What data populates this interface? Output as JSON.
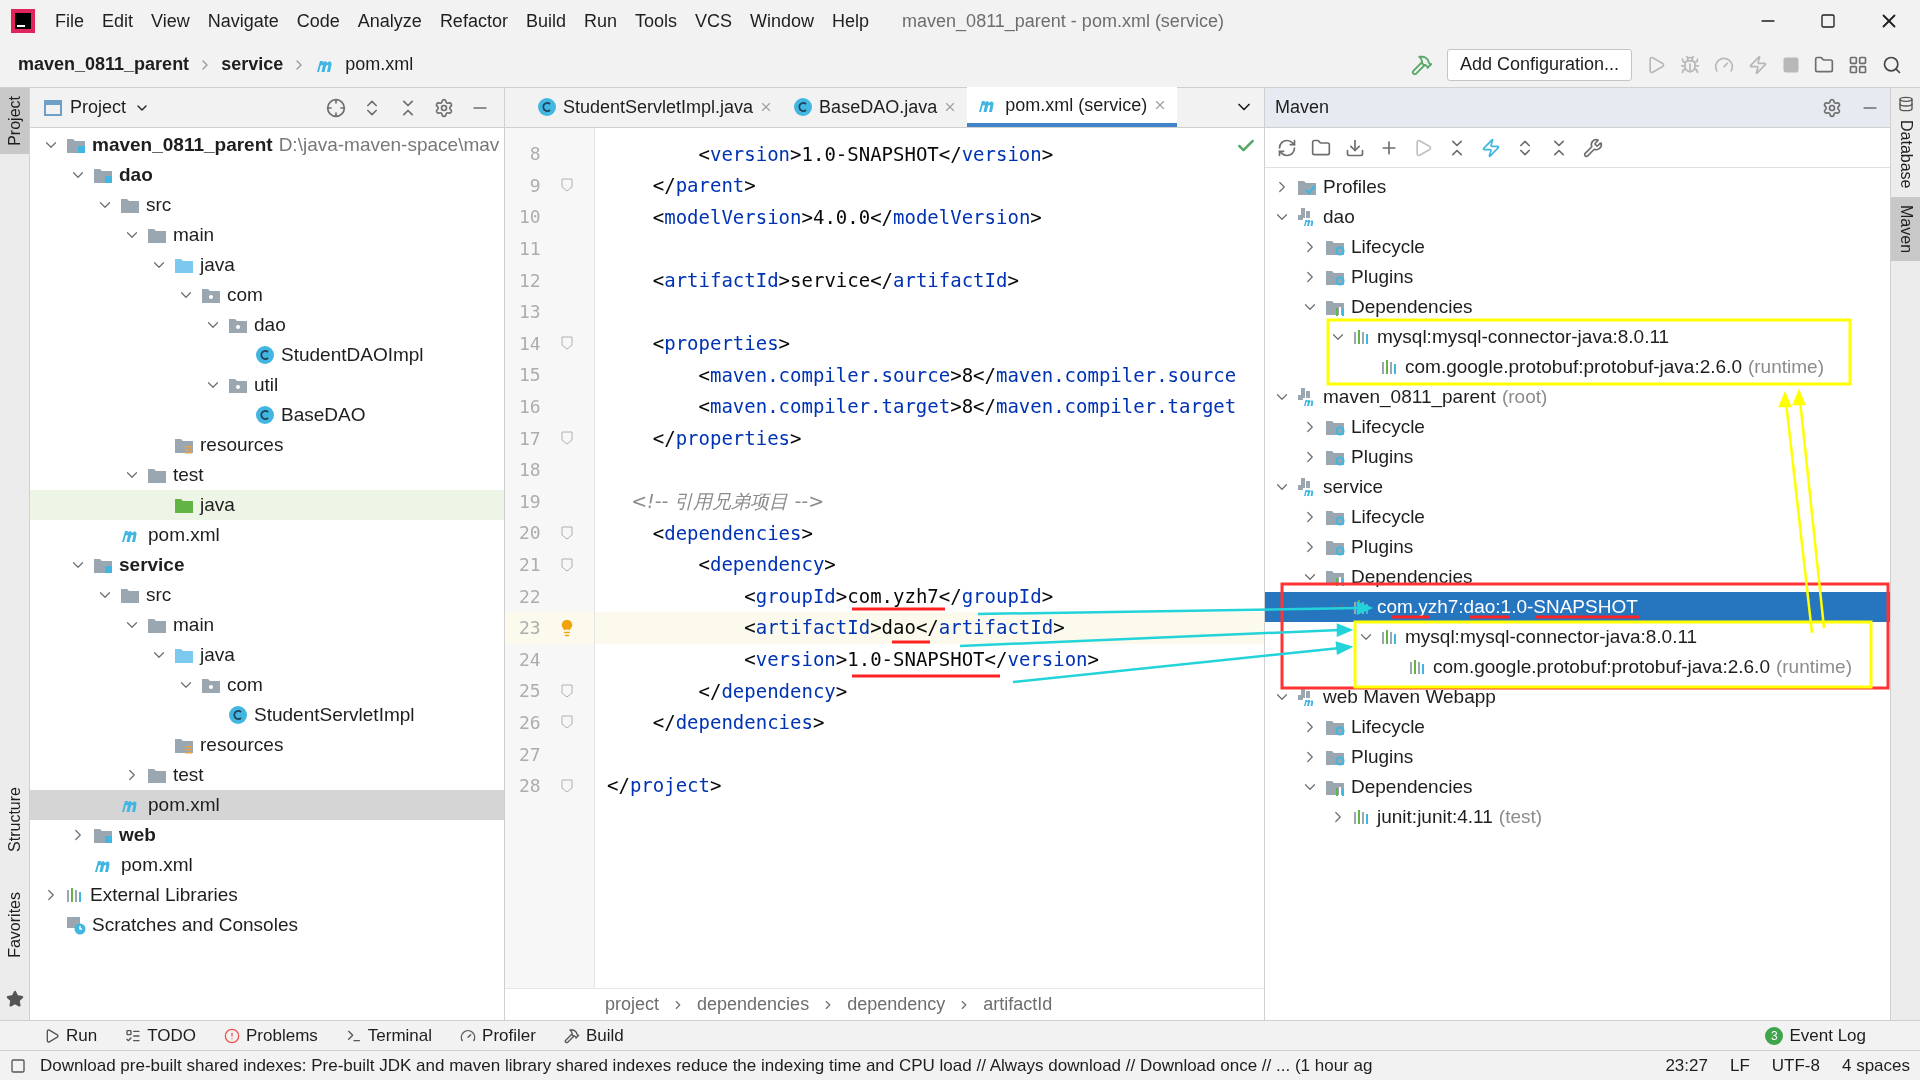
{
  "window": {
    "title": "maven_0811_parent - pom.xml (service)"
  },
  "menu": [
    "File",
    "Edit",
    "View",
    "Navigate",
    "Code",
    "Analyze",
    "Refactor",
    "Build",
    "Run",
    "Tools",
    "VCS",
    "Window",
    "Help"
  ],
  "nav_bar": {
    "crumbs": [
      {
        "label": "maven_0811_parent",
        "kind": "project"
      },
      {
        "label": "service",
        "kind": "module"
      },
      {
        "label": "pom.xml",
        "kind": "pom"
      }
    ],
    "run_config": "Add Configuration..."
  },
  "left_strip": [
    {
      "label": "Project",
      "selected": true
    },
    {
      "label": "Structure",
      "selected": false
    },
    {
      "label": "Favorites",
      "selected": false
    }
  ],
  "right_strip": [
    {
      "label": "Database",
      "selected": false
    },
    {
      "label": "Maven",
      "selected": true
    }
  ],
  "project_panel": {
    "title": "Project",
    "tree": [
      {
        "label": "maven_0811_parent",
        "kind": "module",
        "bold": true,
        "hint": "D:\\java-maven-space\\mav",
        "expanded": true,
        "selected": false,
        "children": [
          {
            "label": "dao",
            "kind": "module",
            "bold": true,
            "expanded": true,
            "selected": false,
            "children": [
              {
                "label": "src",
                "kind": "folder",
                "bold": false,
                "expanded": true,
                "selected": false,
                "children": [
                  {
                    "label": "main",
                    "kind": "folder",
                    "bold": false,
                    "expanded": true,
                    "selected": false,
                    "children": [
                      {
                        "label": "java",
                        "kind": "source",
                        "bold": false,
                        "expanded": true,
                        "selected": false,
                        "children": [
                          {
                            "label": "com",
                            "kind": "package",
                            "bold": false,
                            "expanded": true,
                            "selected": false,
                            "children": [
                              {
                                "label": "dao",
                                "kind": "package",
                                "bold": false,
                                "expanded": true,
                                "selected": false,
                                "children": [
                                  {
                                    "label": "StudentDAOImpl",
                                    "kind": "class",
                                    "bold": false,
                                    "selected": false
                                  }
                                ]
                              },
                              {
                                "label": "util",
                                "kind": "package",
                                "bold": false,
                                "expanded": true,
                                "selected": false,
                                "children": [
                                  {
                                    "label": "BaseDAO",
                                    "kind": "class",
                                    "bold": false,
                                    "selected": false
                                  }
                                ]
                              }
                            ]
                          }
                        ]
                      },
                      {
                        "label": "resources",
                        "kind": "resources",
                        "bold": false,
                        "selected": false
                      }
                    ]
                  },
                  {
                    "label": "test",
                    "kind": "folder",
                    "bold": false,
                    "expanded": true,
                    "selected": false,
                    "children": [
                      {
                        "label": "java",
                        "kind": "test-source",
                        "bold": false,
                        "selected": false
                      }
                    ]
                  }
                ]
              },
              {
                "label": "pom.xml",
                "kind": "pom",
                "bold": false,
                "selected": false
              }
            ]
          },
          {
            "label": "service",
            "kind": "module",
            "bold": true,
            "expanded": true,
            "selected": false,
            "children": [
              {
                "label": "src",
                "kind": "folder",
                "bold": false,
                "expanded": true,
                "selected": false,
                "children": [
                  {
                    "label": "main",
                    "kind": "folder",
                    "bold": false,
                    "expanded": true,
                    "selected": false,
                    "children": [
                      {
                        "label": "java",
                        "kind": "source",
                        "bold": false,
                        "expanded": true,
                        "selected": false,
                        "children": [
                          {
                            "label": "com",
                            "kind": "package",
                            "bold": false,
                            "expanded": true,
                            "selected": false,
                            "children": [
                              {
                                "label": "StudentServletImpl",
                                "kind": "class",
                                "bold": false,
                                "selected": false
                              }
                            ]
                          }
                        ]
                      },
                      {
                        "label": "resources",
                        "kind": "resources",
                        "bold": false,
                        "selected": false
                      }
                    ]
                  },
                  {
                    "label": "test",
                    "kind": "folder",
                    "bold": false,
                    "expanded": false,
                    "selected": false
                  }
                ]
              },
              {
                "label": "pom.xml",
                "kind": "pom",
                "bold": false,
                "selected": true
              }
            ]
          },
          {
            "label": "web",
            "kind": "module",
            "bold": true,
            "expanded": false,
            "selected": false
          },
          {
            "label": "pom.xml",
            "kind": "pom",
            "bold": false,
            "selected": false
          }
        ]
      },
      {
        "label": "External Libraries",
        "kind": "library",
        "bold": false,
        "expanded": false,
        "selected": false
      },
      {
        "label": "Scratches and Consoles",
        "kind": "scratches",
        "bold": false,
        "selected": false
      }
    ]
  },
  "editor": {
    "tabs": [
      {
        "label": "StudentServletImpl.java",
        "kind": "class",
        "selected": false
      },
      {
        "label": "BaseDAO.java",
        "kind": "class",
        "selected": false
      },
      {
        "label": "pom.xml (service)",
        "kind": "pom",
        "selected": true
      }
    ],
    "lines": [
      {
        "number": "8",
        "text": "        <version>1.0-SNAPSHOT</version>",
        "kind": "code",
        "fold": false,
        "current": false
      },
      {
        "number": "9",
        "text": "    </parent>",
        "kind": "code",
        "fold": true,
        "current": false
      },
      {
        "number": "10",
        "text": "    <modelVersion>4.0.0</modelVersion>",
        "kind": "code",
        "fold": false,
        "current": false
      },
      {
        "number": "11",
        "fold": false,
        "current": false
      },
      {
        "number": "12",
        "text": "    <artifactId>service</artifactId>",
        "kind": "code",
        "fold": false,
        "current": false
      },
      {
        "number": "13",
        "fold": false,
        "current": false
      },
      {
        "number": "14",
        "text": "    <properties>",
        "kind": "code",
        "fold": true,
        "current": false
      },
      {
        "number": "15",
        "text": "        <maven.compiler.source>8</maven.compiler.source",
        "kind": "code",
        "fold": false,
        "current": false
      },
      {
        "number": "16",
        "text": "        <maven.compiler.target>8</maven.compiler.target",
        "kind": "code",
        "fold": false,
        "current": false
      },
      {
        "number": "17",
        "text": "    </properties>",
        "kind": "code",
        "fold": true,
        "current": false
      },
      {
        "number": "18",
        "fold": false,
        "current": false
      },
      {
        "number": "19",
        "text": "    <!-- 引用兄弟项目 -->",
        "kind": "comment",
        "fold": false,
        "current": false
      },
      {
        "number": "20",
        "text": "    <dependencies>",
        "kind": "code",
        "fold": true,
        "current": false
      },
      {
        "number": "21",
        "text": "        <dependency>",
        "kind": "code",
        "fold": true,
        "current": false
      },
      {
        "number": "22",
        "text": "            <groupId>com.yzh7</groupId>",
        "kind": "code",
        "fold": false,
        "current": false
      },
      {
        "number": "23",
        "text": "            <artifactId>dao</artifactId>",
        "kind": "code",
        "fold": false,
        "current": true
      },
      {
        "number": "24",
        "text": "            <version>1.0-SNAPSHOT</version>",
        "kind": "code",
        "fold": false,
        "current": false
      },
      {
        "number": "25",
        "text": "        </dependency>",
        "kind": "code",
        "fold": true,
        "current": false
      },
      {
        "number": "26",
        "text": "    </dependencies>",
        "kind": "code",
        "fold": true,
        "current": false
      },
      {
        "number": "27",
        "fold": false,
        "current": false
      },
      {
        "number": "28",
        "text": "</project>",
        "kind": "code",
        "fold": true,
        "current": false
      }
    ],
    "breadcrumbs": [
      "project",
      "dependencies",
      "dependency",
      "artifactId"
    ]
  },
  "maven_panel": {
    "title": "Maven",
    "tree": [
      {
        "label": "Profiles",
        "kind": "profiles",
        "expanded": false,
        "selected": false
      },
      {
        "label": "dao",
        "kind": "project",
        "expanded": true,
        "selected": false,
        "children": [
          {
            "label": "Lifecycle",
            "kind": "lifecycle",
            "expanded": false,
            "selected": false
          },
          {
            "label": "Plugins",
            "kind": "plugins",
            "expanded": false,
            "selected": false
          },
          {
            "label": "Dependencies",
            "kind": "dependencies",
            "expanded": true,
            "selected": false,
            "children": [
              {
                "label": "mysql:mysql-connector-java:8.0.11",
                "kind": "library",
                "expanded": true,
                "selected": false,
                "children": [
                  {
                    "label": "com.google.protobuf:protobuf-java:2.6.0",
                    "suffix": "(runtime)",
                    "kind": "library",
                    "selected": false
                  }
                ]
              }
            ]
          }
        ]
      },
      {
        "label": "maven_0811_parent",
        "suffix": "(root)",
        "kind": "project",
        "expanded": true,
        "selected": false,
        "children": [
          {
            "label": "Lifecycle",
            "kind": "lifecycle",
            "expanded": false,
            "selected": false
          },
          {
            "label": "Plugins",
            "kind": "plugins",
            "expanded": false,
            "selected": false
          }
        ]
      },
      {
        "label": "service",
        "kind": "project",
        "expanded": true,
        "selected": false,
        "children": [
          {
            "label": "Lifecycle",
            "kind": "lifecycle",
            "expanded": false,
            "selected": false
          },
          {
            "label": "Plugins",
            "kind": "plugins",
            "expanded": false,
            "selected": false
          },
          {
            "label": "Dependencies",
            "kind": "dependencies",
            "expanded": true,
            "selected": false,
            "children": [
              {
                "label": "com.yzh7:dao:1.0-SNAPSHOT",
                "kind": "library",
                "expanded": true,
                "selected": true,
                "children": [
                  {
                    "label": "mysql:mysql-connector-java:8.0.11",
                    "kind": "library",
                    "expanded": true,
                    "selected": false,
                    "children": [
                      {
                        "label": "com.google.protobuf:protobuf-java:2.6.0",
                        "suffix": "(runtime)",
                        "kind": "library",
                        "selected": false
                      }
                    ]
                  }
                ]
              }
            ]
          }
        ]
      },
      {
        "label": "web Maven Webapp",
        "kind": "project",
        "expanded": true,
        "selected": false,
        "children": [
          {
            "label": "Lifecycle",
            "kind": "lifecycle",
            "expanded": false,
            "selected": false
          },
          {
            "label": "Plugins",
            "kind": "plugins",
            "expanded": false,
            "selected": false
          },
          {
            "label": "Dependencies",
            "kind": "dependencies",
            "expanded": true,
            "selected": false,
            "children": [
              {
                "label": "junit:junit:4.11",
                "suffix": "(test)",
                "kind": "library",
                "expanded": false,
                "selected": false
              }
            ]
          }
        ]
      }
    ]
  },
  "tool_tabs": [
    {
      "label": "Run",
      "kind": "run"
    },
    {
      "label": "TODO",
      "kind": "todo"
    },
    {
      "label": "Problems",
      "kind": "problems"
    },
    {
      "label": "Terminal",
      "kind": "terminal"
    },
    {
      "label": "Profiler",
      "kind": "profiler"
    },
    {
      "label": "Build",
      "kind": "build"
    }
  ],
  "event_log": {
    "label": "Event Log",
    "count": "3"
  },
  "status_bar": {
    "message": "Download pre-built shared indexes: Pre-built JDK and maven library shared indexes reduce the indexing time and CPU load // Always download // Download once // ... (1 hour ag",
    "items": [
      "23:27",
      "LF",
      "UTF-8",
      "4 spaces"
    ]
  }
}
